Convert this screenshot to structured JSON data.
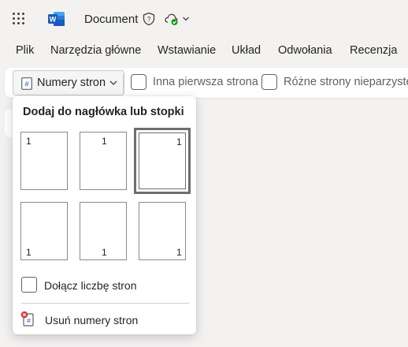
{
  "titlebar": {
    "app_icon": "word-icon",
    "document_title": "Document",
    "icons": [
      "app-launcher-icon",
      "shield-icon",
      "cloud-saved-icon",
      "chevron-down-icon"
    ]
  },
  "menu": {
    "items": [
      "Plik",
      "Narzędzia główne",
      "Wstawianie",
      "Układ",
      "Odwołania",
      "Recenzja"
    ]
  },
  "ribbon": {
    "page_numbers_label": "Numery stron",
    "different_first_label": "Inna pierwsza strona",
    "odd_even_label": "Różne strony nieparzyste"
  },
  "dropdown": {
    "title": "Dodaj do nagłówka lub stopki",
    "page_number_value": "1",
    "positions": [
      "top-left",
      "top-center",
      "top-right",
      "bottom-left",
      "bottom-center",
      "bottom-right"
    ],
    "selected_position": "top-right",
    "include_count_label": "Dołącz liczbę stron",
    "include_count_checked": false,
    "remove_label": "Usuń numery stron"
  },
  "colors": {
    "background": "#f3f2f1",
    "surface": "#ffffff",
    "word_blue": "#185abd",
    "saved_green": "#13a10e",
    "remove_red": "#d13438"
  }
}
